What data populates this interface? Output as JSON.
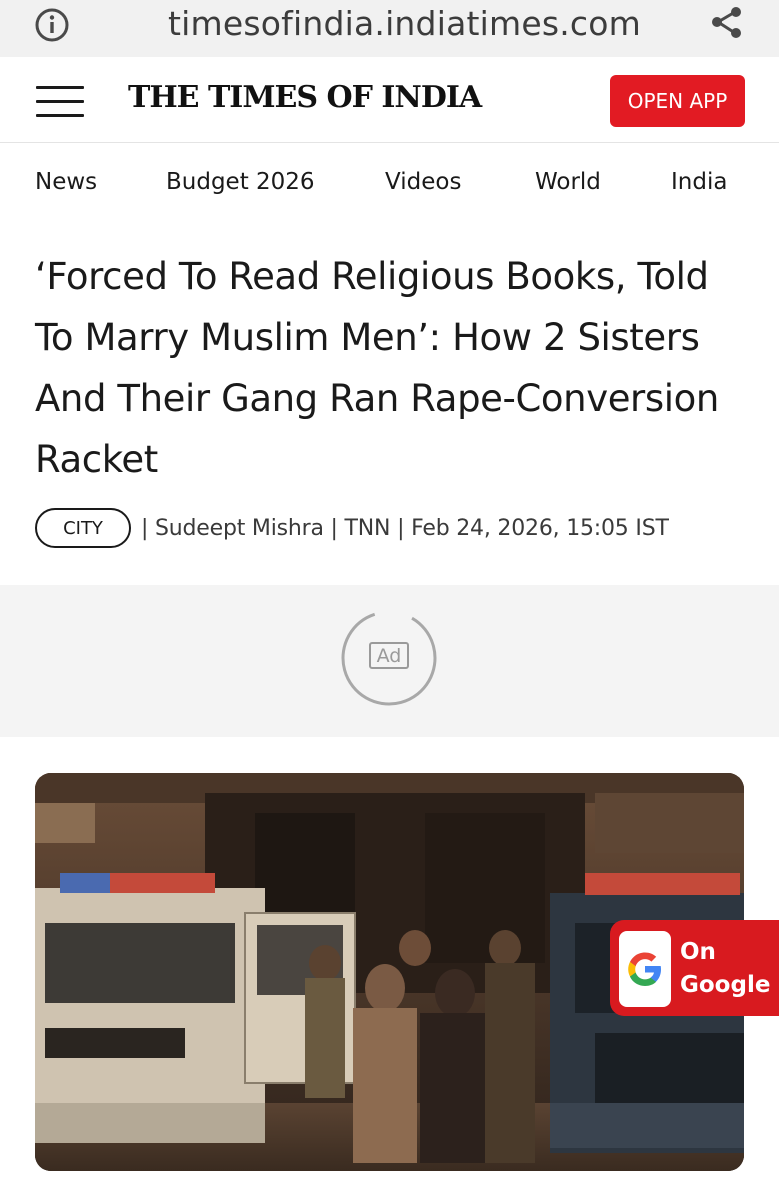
{
  "browser": {
    "url": "timesofindia.indiatimes.com",
    "icons": [
      "info-icon",
      "share-icon"
    ]
  },
  "header": {
    "logo": "THE TIMES OF INDIA",
    "open_app": "OPEN APP",
    "menu_icon": "hamburger-menu-icon",
    "accent_color": "#e21b23"
  },
  "nav": {
    "items": [
      "News",
      "Budget 2026",
      "Videos",
      "World",
      "India"
    ]
  },
  "article": {
    "headline": "‘Forced To Read Religious Books, Told To Marry Muslim Men’: How 2 Sisters And Their Gang Ran Rape-Conversion Racket",
    "category": "CITY",
    "byline": "| Sudeept Mishra | TNN | Feb 24, 2026, 15:05 IST"
  },
  "ad": {
    "label": "Ad"
  },
  "google_badge": {
    "line1": "On",
    "line2": "Google",
    "color": "#d81a1f"
  }
}
